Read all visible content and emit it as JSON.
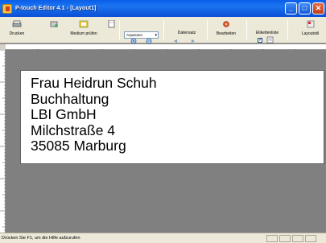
{
  "window": {
    "title": "P-touch Editor 4.1 - [Layout1]"
  },
  "toolbar": {
    "print": "Drucken",
    "check_media": "Medium prüfen",
    "zoom_value": "Anpassen",
    "database": "Datensatz",
    "edit": "Bearbeiten",
    "label_list": "Etikettenliste",
    "layout_style": "Layoutstil"
  },
  "label": {
    "lines": [
      "Frau Heidrun Schuh",
      "Buchhaltung",
      "LBI GmbH",
      "Milchstraße 4",
      "35085 Marburg"
    ]
  },
  "statusbar": {
    "text": "Drücken Sie F1, um die Hilfe aufzurufen"
  },
  "colors": {
    "titlebar": "#0a5ee8",
    "toolbar": "#ece9d8",
    "workspace": "#808080"
  }
}
